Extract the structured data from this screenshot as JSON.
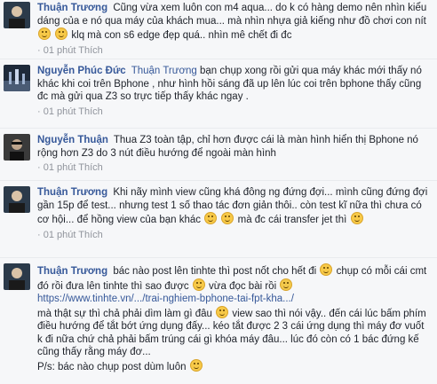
{
  "comments": [
    {
      "author": "Thuận Trương",
      "text": "Cũng vừa xem luôn con m4 aqua... do k có hàng demo nên nhìn kiểu dáng của e nó qua máy của khách mua... mà nhìn nhựa giả kiếng như đồ chơi con nít",
      "text_after": "klq mà con s6 edge đẹp quá.. nhìn mê chết đi đc",
      "time": "· 01 phút",
      "like": "Thích",
      "avatar_icon": "user-avatar-icon"
    },
    {
      "author": "Nguyễn Phúc Đức",
      "mention": "Thuận Trương",
      "text": "bạn chụp xong rồi gửi qua máy khác mới thấy nó khác khi coi trên Bphone , như hình hồi sáng đã up lên lúc coi trên bphone thấy cũng đc mà gửi qua Z3 so trực tiếp thấy khác ngay .",
      "time": "· 01 phút",
      "like": "Thích",
      "avatar_icon": "user-avatar-icon"
    },
    {
      "author": "Nguyễn Thuận",
      "text": "Thua Z3 toàn tập, chỉ hơn được cái là màn hình hiển thị Bphone nó rộng hơn Z3 do 3 nút điều hướng để ngoài màn hình",
      "time": "· 01 phút",
      "like": "Thích",
      "avatar_icon": "user-avatar-icon"
    },
    {
      "author": "Thuận Trương",
      "text": "Khi nãy mình view cũng khá đông ng đứng đợi... mình cũng đứng đợi gần 15p để test... nhưng test 1 số thao tác đơn giản thôi.. còn test kĩ nữa thì chưa có cơ hội... để hồng view của bạn khác",
      "text_after": "mà đc cái transfer jet thì",
      "time": "· 01 phút",
      "like": "Thích",
      "avatar_icon": "user-avatar-icon"
    },
    {
      "author": "Thuận Trương",
      "text": "bác nào post lên tinhte thì post nốt cho hết đi",
      "text_2": "chụp có mỗi cái cmt đó rồi đưa lên tinhte thì sao được",
      "text_3": "vừa đọc bài rồi",
      "link": "https://www.tinhte.vn/.../trai-nghiem-bphone-tai-fpt-kha.../",
      "text_4": "mà thật sự thì chả phải dìm làm gì đâu",
      "text_5": "view sao thì nói vậy.. đến cái lúc bấm phím điều hướng để tắt bớt ứng dụng đấy... kéo tắt được 2 3 cái ứng dụng thì máy đơ vuốt k đi nữa chứ chả phải bấm trúng cái gì khóa máy đâu... lúc đó còn có 1 bác đứng kế cũng thấy rằng máy đơ...",
      "text_6": "P/s: bác nào chụp post dùm luôn",
      "avatar_icon": "user-avatar-icon"
    }
  ]
}
